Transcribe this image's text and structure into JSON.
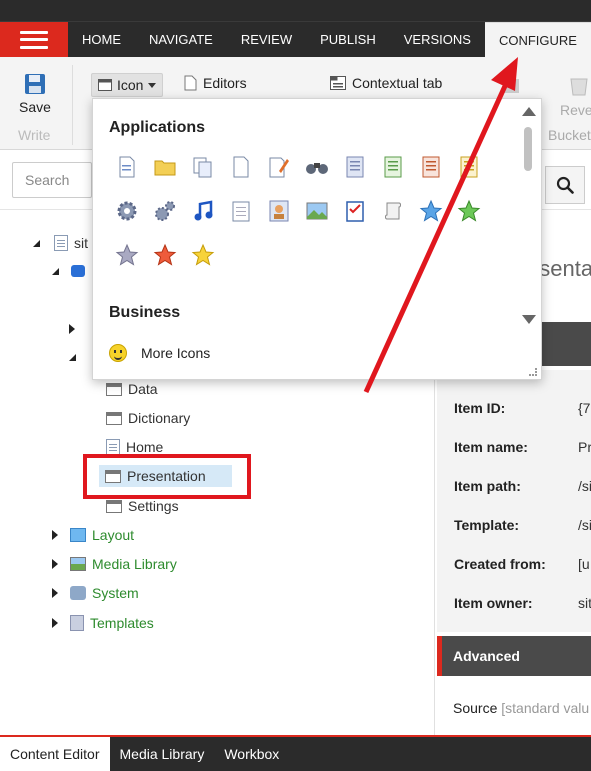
{
  "topnav": {
    "menu_icon": "hamburger-menu-icon",
    "tabs": [
      {
        "label": "HOME",
        "active": false
      },
      {
        "label": "NAVIGATE",
        "active": false
      },
      {
        "label": "REVIEW",
        "active": false
      },
      {
        "label": "PUBLISH",
        "active": false
      },
      {
        "label": "VERSIONS",
        "active": false
      },
      {
        "label": "CONFIGURE",
        "active": true
      }
    ]
  },
  "ribbon": {
    "save_label": "Save",
    "write_label": "Write",
    "icon_dropdown_label": "Icon",
    "editors_label": "Editors",
    "contextual_tab_label": "Contextual tab",
    "reve_label": "Reve",
    "bucket_label": "Bucket"
  },
  "search": {
    "placeholder": "Search"
  },
  "icon_popup": {
    "group_applications": "Applications",
    "group_business": "Business",
    "more_icons_label": "More Icons",
    "icons": [
      "document-icon",
      "folder-icon",
      "documents-icon",
      "blank-page-icon",
      "edit-page-icon",
      "binoculars-icon",
      "list-page-icon",
      "green-list-icon",
      "red-list-icon",
      "yellow-list-icon",
      "gear-icon",
      "gears-icon",
      "music-note-icon",
      "notepad-icon",
      "user-card-icon",
      "picture-icon",
      "checklist-icon",
      "scroll-icon",
      "blue-star-icon",
      "green-star-icon",
      "gray-star-icon",
      "red-star-icon",
      "yellow-star-icon"
    ]
  },
  "tree": {
    "root_label": "sit",
    "children": [
      "Data",
      "Dictionary",
      "Home",
      "Presentation",
      "Settings"
    ],
    "selected": "Presentation",
    "top_nodes": [
      "Layout",
      "Media Library",
      "System",
      "Templates"
    ]
  },
  "details": {
    "title_partial": "esenta",
    "fields": [
      {
        "label": "Item ID:",
        "value": "{7"
      },
      {
        "label": "Item name:",
        "value": "Pr"
      },
      {
        "label": "Item path:",
        "value": "/si"
      },
      {
        "label": "Template:",
        "value": "/si"
      },
      {
        "label": "Created from:",
        "value": "[u"
      },
      {
        "label": "Item owner:",
        "value": "sit"
      }
    ],
    "advanced_label": "Advanced",
    "source_label": "Source",
    "source_muted": "[standard valu"
  },
  "bottom_tabs": [
    {
      "label": "Content Editor",
      "active": true
    },
    {
      "label": "Media Library",
      "active": false
    },
    {
      "label": "Workbox",
      "active": false
    }
  ],
  "colors": {
    "brand_red": "#dc291e",
    "nav_bg": "#2b2b2b",
    "tree_green": "#2e8b2e",
    "selection_bg": "#d6e9f7"
  }
}
